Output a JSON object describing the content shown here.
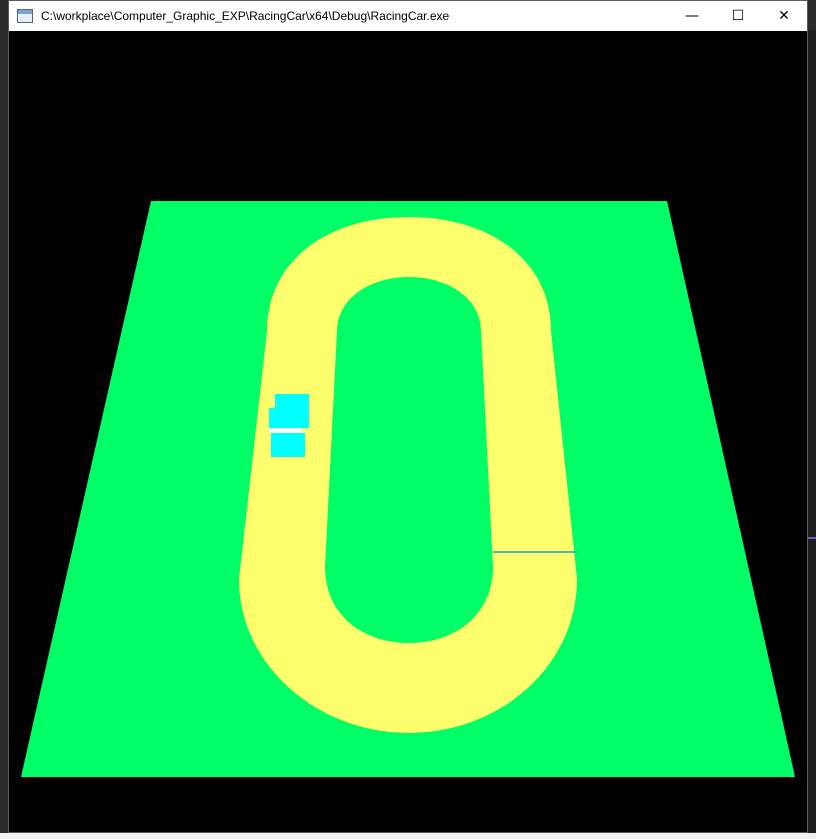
{
  "window": {
    "title": "C:\\workplace\\Computer_Graphic_EXP\\RacingCar\\x64\\Debug\\RacingCar.exe",
    "icon": "console-window-icon",
    "controls": {
      "minimize_glyph": "—",
      "maximize_glyph": "☐",
      "close_glyph": "✕"
    }
  },
  "scene": {
    "background_color": "#000000",
    "ground_color": "#00ff66",
    "track_color": "#ffff6e",
    "infield_color": "#00ff66",
    "finish_line_color": "#1aa0c8",
    "car_color": "#00ffff",
    "car_stripe_color": "#ffffff"
  }
}
